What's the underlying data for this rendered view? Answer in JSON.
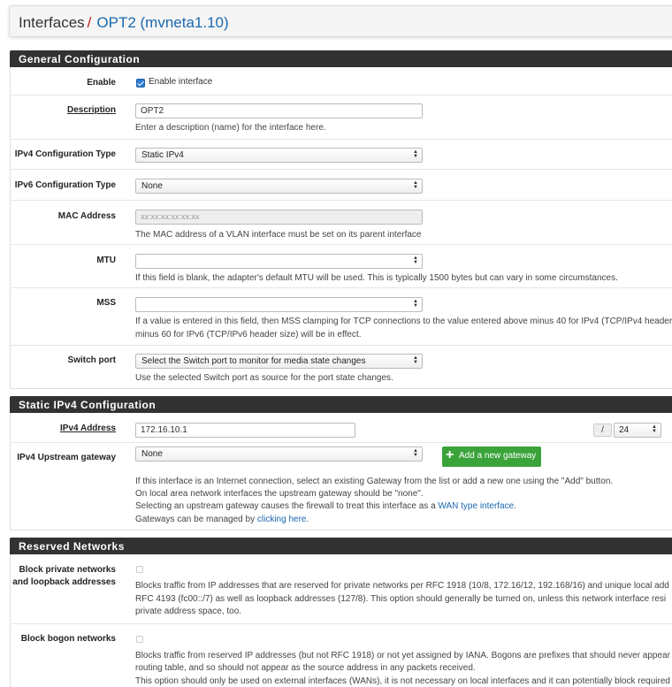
{
  "breadcrumb": {
    "root": "Interfaces",
    "separator": "/",
    "current": "OPT2 (mvneta1.10)"
  },
  "general": {
    "heading": "General Configuration",
    "enable": {
      "label": "Enable",
      "checkbox_label": "Enable interface",
      "checked": true
    },
    "description": {
      "label": "Description",
      "value": "OPT2",
      "help": "Enter a description (name) for the interface here."
    },
    "ipv4_type": {
      "label": "IPv4 Configuration Type",
      "value": "Static IPv4"
    },
    "ipv6_type": {
      "label": "IPv6 Configuration Type",
      "value": "None"
    },
    "mac": {
      "label": "MAC Address",
      "placeholder": "xx:xx:xx:xx:xx:xx",
      "help": "The MAC address of a VLAN interface must be set on its parent interface"
    },
    "mtu": {
      "label": "MTU",
      "help": "If this field is blank, the adapter's default MTU will be used. This is typically 1500 bytes but can vary in some circumstances."
    },
    "mss": {
      "label": "MSS",
      "help1": "If a value is entered in this field, then MSS clamping for TCP connections to the value entered above minus 40 for IPv4 (TCP/IPv4 header",
      "help2": "minus 60 for IPv6 (TCP/IPv6 header size) will be in effect."
    },
    "switch_port": {
      "label": "Switch port",
      "value": "Select the Switch port to monitor for media state changes",
      "help": "Use the selected Switch port as source for the port state changes."
    }
  },
  "static_ipv4": {
    "heading": "Static IPv4 Configuration",
    "address": {
      "label": "IPv4 Address",
      "value": "172.16.10.1",
      "slash": "/",
      "cidr": "24"
    },
    "gateway": {
      "label": "IPv4 Upstream gateway",
      "value": "None",
      "button": "Add a new gateway",
      "help1": "If this interface is an Internet connection, select an existing Gateway from the list or add a new one using the \"Add\" button.",
      "help2": "On local area network interfaces the upstream gateway should be \"none\".",
      "help3_pre": "Selecting an upstream gateway causes the firewall to treat this interface as a ",
      "help3_link": "WAN type interface",
      "help3_post": ".",
      "help4_pre": "Gateways can be managed by ",
      "help4_link": "clicking here",
      "help4_post": "."
    }
  },
  "reserved": {
    "heading": "Reserved Networks",
    "private": {
      "label": "Block private networks and loopback addresses",
      "checked": false,
      "help1": "Blocks traffic from IP addresses that are reserved for private networks per RFC 1918 (10/8, 172.16/12, 192.168/16) and unique local add",
      "help2": "RFC 4193 (fc00::/7) as well as loopback addresses (127/8). This option should generally be turned on, unless this network interface resi",
      "help3": "private address space, too."
    },
    "bogon": {
      "label": "Block bogon networks",
      "checked": false,
      "help1": "Blocks traffic from reserved IP addresses (but not RFC 1918) or not yet assigned by IANA. Bogons are prefixes that should never appear",
      "help2": "routing table, and so should not appear as the source address in any packets received.",
      "help3": "This option should only be used on external interfaces (WANs), it is not necessary on local interfaces and it can potentially block required"
    }
  }
}
